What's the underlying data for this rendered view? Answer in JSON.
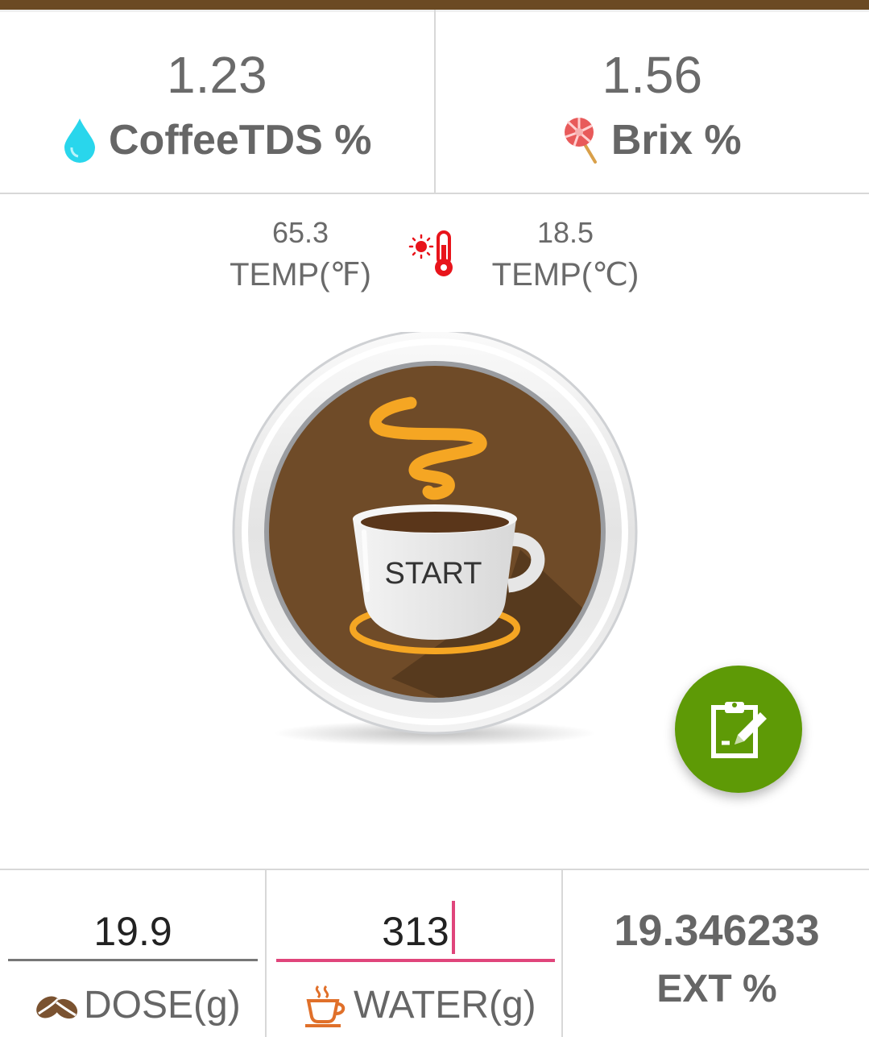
{
  "readings": {
    "tds": {
      "value": "1.23",
      "label": "CoffeeTDS %",
      "icon": "water-drop-icon",
      "icon_color": "#29d6ec"
    },
    "brix": {
      "value": "1.56",
      "label": "Brix %",
      "icon": "lollipop-icon"
    }
  },
  "temperature": {
    "fahrenheit": {
      "value": "65.3",
      "label": "TEMP(℉)"
    },
    "celsius": {
      "value": "18.5",
      "label": "TEMP(℃)"
    },
    "icon": "thermometer-sun-icon",
    "icon_color": "#e8141b"
  },
  "start_button": {
    "label": "START",
    "icon": "coffee-cup-icon"
  },
  "fab": {
    "icon": "clipboard-edit-icon",
    "color": "#5e9a06"
  },
  "inputs": {
    "dose": {
      "value": "19.9",
      "label": "DOSE(g)",
      "icon": "coffee-beans-icon"
    },
    "water": {
      "value": "313",
      "label": "WATER(g)",
      "icon": "hot-cup-icon",
      "focused": true,
      "accent": "#e0457b"
    }
  },
  "extraction": {
    "value": "19.346233",
    "label": "EXT %"
  },
  "theme": {
    "brand_brown": "#6b4a23",
    "accent_orange": "#f5a623"
  }
}
